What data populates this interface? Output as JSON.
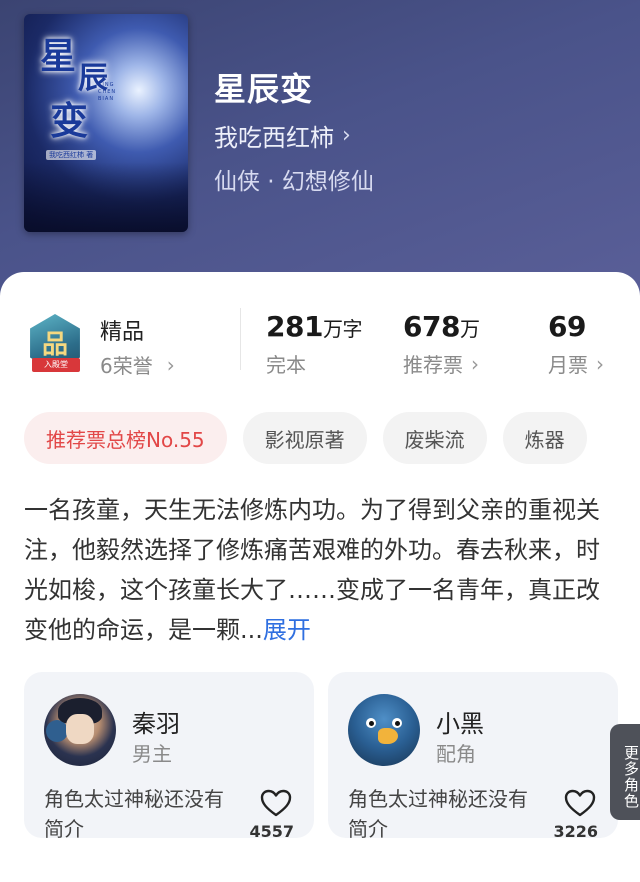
{
  "book": {
    "title": "星辰变",
    "author": "我吃西红柿",
    "author_chevron": "›",
    "genre": "仙侠 · 幻想修仙",
    "cover": {
      "title_chars": [
        "星",
        "辰",
        "变"
      ],
      "subtitle": "XING CHEN BIAN",
      "author": "我吃西红柿 著"
    }
  },
  "badge": {
    "glyph": "品",
    "ribbon": "入殿堂"
  },
  "quality": {
    "title": "精品",
    "honor": "6荣誉"
  },
  "stats": {
    "words": {
      "value": "281",
      "unit": "万字",
      "label": "完本"
    },
    "recommend": {
      "value": "678",
      "unit": "万",
      "label": "推荐票"
    },
    "monthly": {
      "value": "69",
      "unit": "",
      "label": "月票"
    }
  },
  "chevron": "›",
  "tags": [
    "推荐票总榜No.55",
    "影视原著",
    "废柴流",
    "炼器"
  ],
  "description": {
    "text": "一名孩童，天生无法修炼内功。为了得到父亲的重视关注，他毅然选择了修炼痛苦艰难的外功。春去秋来，时光如梭，这个孩童长大了……变成了一名青年，真正改变他的命运，是一颗...",
    "expand": "展开"
  },
  "roles": [
    {
      "name": "秦羽",
      "type": "男主",
      "intro": "角色太过神秘还没有简介",
      "likes": "4557",
      "avatar_icon": "hero-avatar"
    },
    {
      "name": "小黑",
      "type": "配角",
      "intro": "角色太过神秘还没有简介",
      "likes": "3226",
      "avatar_icon": "bird-avatar"
    }
  ],
  "more_roles": "更多角色",
  "colors": {
    "hero_bg": "#4a538a",
    "tag_hot": "#e24747",
    "expand_link": "#2f6fe0",
    "role_card_bg": "#f2f4f8"
  }
}
